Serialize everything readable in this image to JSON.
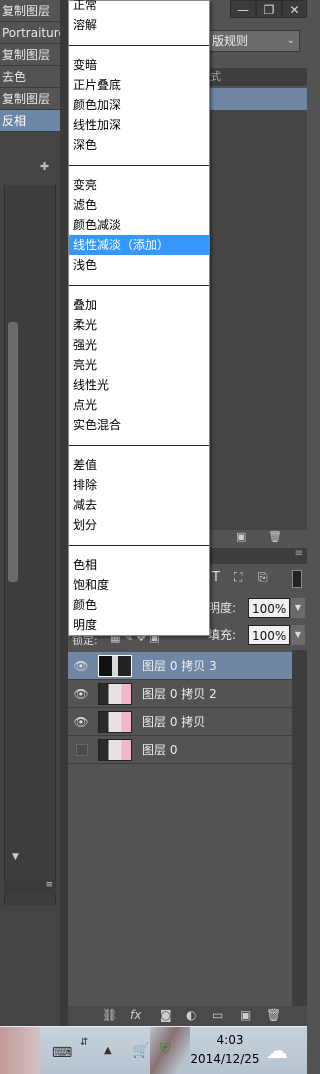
{
  "history": {
    "items": [
      {
        "label": "复制图层",
        "active": false
      },
      {
        "label": "Portraiture",
        "active": false
      },
      {
        "label": "复制图层",
        "active": false
      },
      {
        "label": "去色",
        "active": false
      },
      {
        "label": "复制图层",
        "active": false
      },
      {
        "label": "反相",
        "active": true
      }
    ]
  },
  "composition": {
    "selected": "版规则"
  },
  "style_tab": {
    "label": "式"
  },
  "blend_menu": {
    "groups": [
      [
        "正常",
        "溶解"
      ],
      [
        "变暗",
        "正片叠底",
        "颜色加深",
        "线性加深",
        "深色"
      ],
      [
        "变亮",
        "滤色",
        "颜色减淡",
        "线性减淡（添加）",
        "浅色"
      ],
      [
        "叠加",
        "柔光",
        "强光",
        "亮光",
        "线性光",
        "点光",
        "实色混合"
      ],
      [
        "差值",
        "排除",
        "减去",
        "划分"
      ],
      [
        "色相",
        "饱和度",
        "颜色",
        "明度"
      ]
    ],
    "highlighted": "线性减淡（添加）"
  },
  "layers": {
    "opacity_label": "明度:",
    "opacity_value": "100%",
    "lock_label": "锁定:",
    "fill_label": "填充:",
    "fill_value": "100%",
    "rows": [
      {
        "name": "图层 0 拷贝 3",
        "visible": true,
        "selected": true
      },
      {
        "name": "图层 0 拷贝 2",
        "visible": true,
        "selected": false
      },
      {
        "name": "图层 0 拷贝",
        "visible": true,
        "selected": false
      },
      {
        "name": "图层 0",
        "visible": false,
        "selected": false
      }
    ]
  },
  "taskbar": {
    "time": "4:03",
    "date": "2014/12/25"
  },
  "colors": {
    "menu_highlight": "#3399ff",
    "selection_blue": "#6f87a5",
    "panel_bg": "#535353"
  }
}
